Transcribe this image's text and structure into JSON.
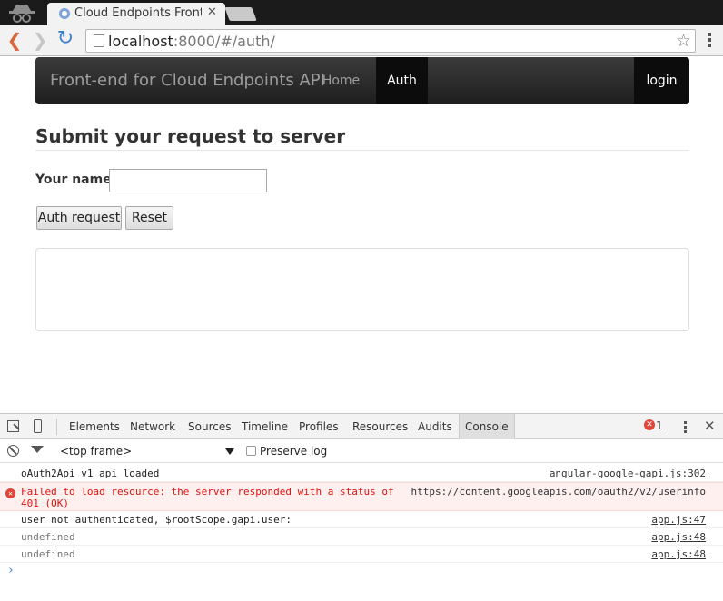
{
  "browser": {
    "tab_title": "Cloud Endpoints Fronten",
    "url_host": "localhost",
    "url_rest": ":8000/#/auth/"
  },
  "navbar": {
    "brand": "Front-end for Cloud Endpoints API",
    "home": "Home",
    "auth": "Auth",
    "login": "login"
  },
  "form": {
    "heading": "Submit your request to server",
    "name_label": "Your name:",
    "name_value": "",
    "auth_button": "Auth request",
    "reset_button": "Reset"
  },
  "devtools": {
    "tabs": [
      "Elements",
      "Network",
      "Sources",
      "Timeline",
      "Profiles",
      "Resources",
      "Audits",
      "Console"
    ],
    "active_tab": "Console",
    "error_count": "1",
    "frame": "<top frame>",
    "preserve_log": "Preserve log",
    "logs": [
      {
        "msg": "oAuth2Api v1 api loaded",
        "src": "angular-google-gapi.js:302",
        "level": "info"
      },
      {
        "msg": "Failed to load resource: the server responded with a status of\n401 (OK)",
        "src": "https://content.googleapis.com/oauth2/v2/userinfo",
        "level": "error"
      },
      {
        "msg": "user not authenticated, $rootScope.gapi.user:",
        "src": "app.js:47",
        "level": "info"
      },
      {
        "msg": "undefined",
        "src": "app.js:48",
        "level": "dim"
      },
      {
        "msg": "undefined",
        "src": "app.js:48",
        "level": "dim"
      }
    ]
  },
  "colors": {
    "navbar_bg": "#222222",
    "error_text": "#e0130e",
    "error_bg": "#fff0f0",
    "link_blue": "#3e79d6"
  }
}
